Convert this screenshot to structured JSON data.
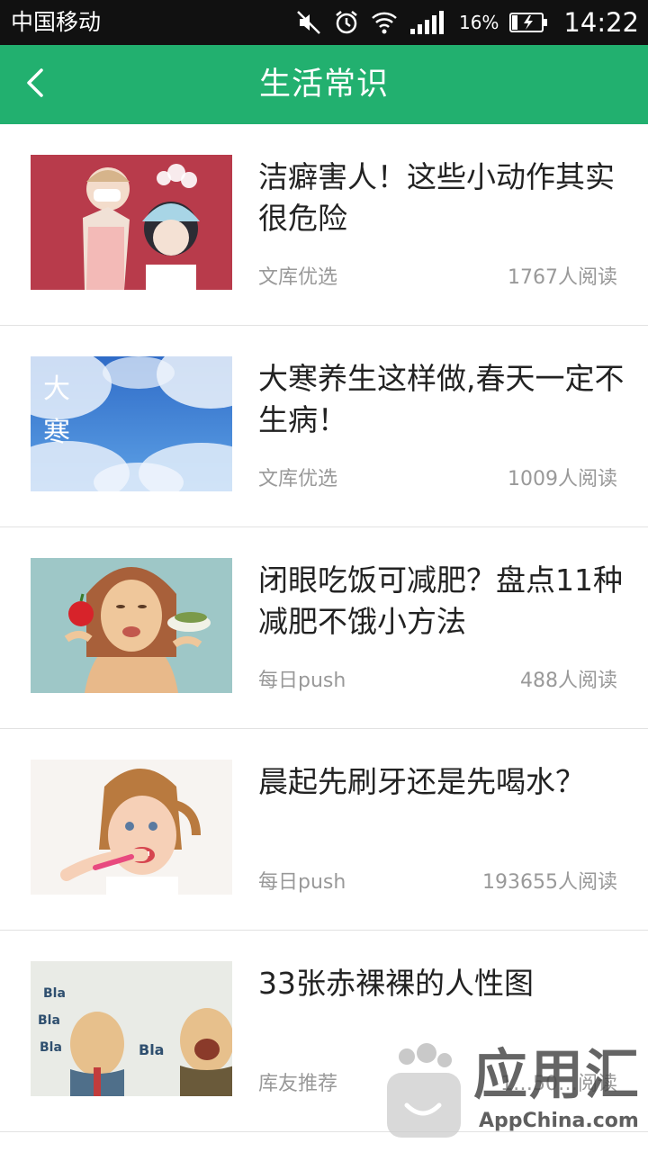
{
  "status_bar": {
    "carrier": "中国移动",
    "battery": "16%",
    "time": "14:22",
    "icons": [
      "mute-icon",
      "alarm-icon",
      "wifi-icon",
      "signal-icon",
      "battery-charging-icon"
    ]
  },
  "header": {
    "title": "生活常识",
    "back_icon": "chevron-left-icon",
    "background": "#22b06f"
  },
  "articles": [
    {
      "title": "洁癖害人！这些小动作其实很危险",
      "source": "文库优选",
      "reads": "1767",
      "reads_suffix": "人阅读",
      "thumbnail": "cartoon-cleaning-girls"
    },
    {
      "title": "大寒养生这样做,春天一定不生病！",
      "source": "文库优选",
      "reads": "1009",
      "reads_suffix": "人阅读",
      "thumbnail_text": "大寒"
    },
    {
      "title": "闭眼吃饭可减肥？盘点11种减肥不饿小方法",
      "source": "每日push",
      "reads": "488",
      "reads_suffix": "人阅读",
      "thumbnail": "woman-eating-illustration"
    },
    {
      "title": "晨起先刷牙还是先喝水？",
      "source": "每日push",
      "reads": "193655",
      "reads_suffix": "人阅读",
      "thumbnail": "girl-brushing-teeth"
    },
    {
      "title": "33张赤裸裸的人性图",
      "source": "库友推荐",
      "reads": "1…50…",
      "reads_suffix": "阅读",
      "thumbnail": "two-men-cartoon"
    }
  ],
  "watermark": {
    "cn": "应用汇",
    "en": "AppChina.com"
  }
}
